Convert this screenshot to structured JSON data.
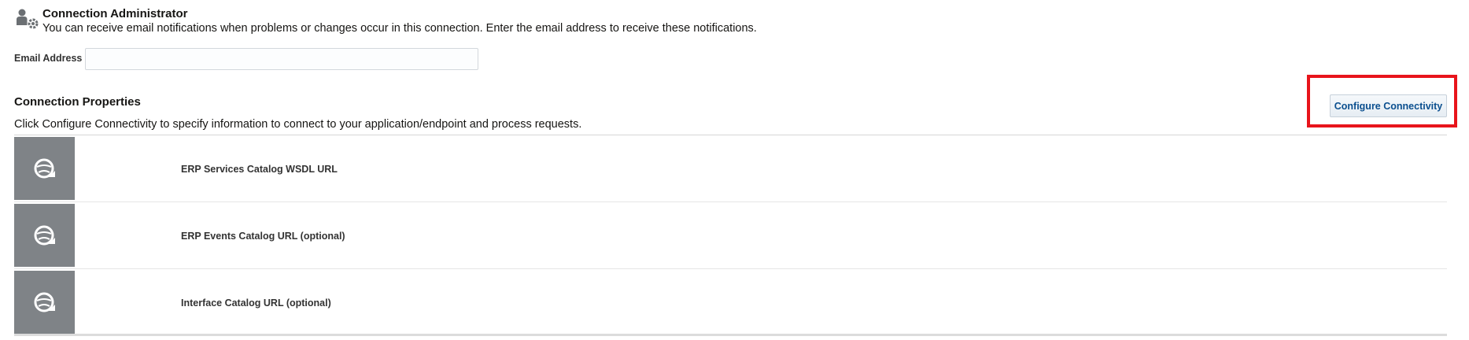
{
  "admin": {
    "icon": "user-gear-icon",
    "title": "Connection Administrator",
    "description": "You can receive email notifications when problems or changes occur in this connection. Enter the email address to receive these notifications."
  },
  "email": {
    "label": "Email Address",
    "value": "",
    "placeholder": ""
  },
  "properties": {
    "title": "Connection Properties",
    "description": "Click Configure Connectivity to specify information to connect to your application/endpoint and process requests.",
    "configure_label": "Configure Connectivity",
    "highlight_color": "#e8141b",
    "rows": [
      {
        "label": "ERP Services Catalog WSDL URL",
        "icon": "globe-refresh-icon"
      },
      {
        "label": "ERP Events Catalog URL (optional)",
        "icon": "globe-refresh-icon"
      },
      {
        "label": "Interface Catalog URL (optional)",
        "icon": "globe-refresh-icon"
      }
    ]
  }
}
